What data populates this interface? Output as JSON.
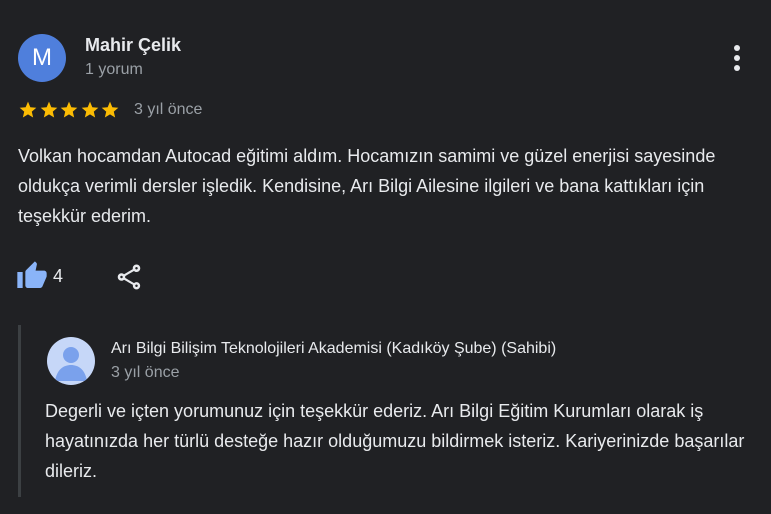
{
  "review": {
    "author_initial": "M",
    "author_name": "Mahir Çelik",
    "author_meta": "1 yorum",
    "rating": 5,
    "rating_max": 5,
    "date": "3 yıl önce",
    "text": "Volkan hocamdan Autocad eğitimi aldım. Hocamızın samimi ve güzel enerjisi sayesinde oldukça verimli dersler işledik. Kendisine, Arı Bilgi Ailesine ilgileri ve bana kattıkları için teşekkür ederim.",
    "like_count": "4"
  },
  "owner_reply": {
    "name": "Arı Bilgi Bilişim Teknolojileri Akademisi (Kadıköy Şube) (Sahibi)",
    "date": "3 yıl önce",
    "text": "Degerli ve içten yorumunuz için teşekkür ederiz. Arı Bilgi Eğitim Kurumları olarak iş hayatınızda her türlü desteğe hazır olduğumuzu bildirmek isteriz. Kariyerinizde başarılar dileriz."
  },
  "icons": {
    "more": "more-vert-icon",
    "star": "star-icon",
    "like": "thumb-up-icon",
    "share": "share-icon",
    "owner_avatar": "person-icon"
  },
  "colors": {
    "background": "#202124",
    "avatar": "#4f7fdc",
    "star": "#fbbc04",
    "like": "#8ab4f8",
    "text": "#e8eaed",
    "muted": "#9aa0a6",
    "reply_border": "#3c4043"
  }
}
